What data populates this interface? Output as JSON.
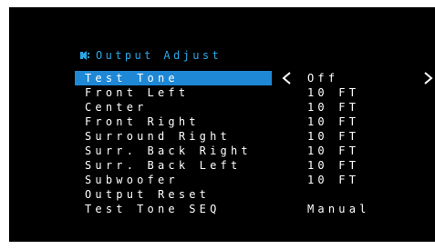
{
  "colors": {
    "background": "#000000",
    "accent": "#2aa6e6",
    "selection": "#1e88d6",
    "text": "#ffffff"
  },
  "header": {
    "icon": "speaker-settings-icon",
    "title": "Output Adjust"
  },
  "menu": {
    "items": [
      {
        "label": "Test Tone",
        "value": "Off",
        "selected": true
      },
      {
        "label": "Front Left",
        "value": "10 FT"
      },
      {
        "label": "Center",
        "value": "10 FT"
      },
      {
        "label": "Front Right",
        "value": "10 FT"
      },
      {
        "label": "Surround Right",
        "value": "10 FT"
      },
      {
        "label": "Surr. Back Right",
        "value": "10 FT"
      },
      {
        "label": "Surr. Back Left",
        "value": "10 FT"
      },
      {
        "label": "Subwoofer",
        "value": "10 FT"
      },
      {
        "label": "Output Reset",
        "value": ""
      },
      {
        "label": "Test Tone SEQ",
        "value": "Manual"
      }
    ]
  }
}
